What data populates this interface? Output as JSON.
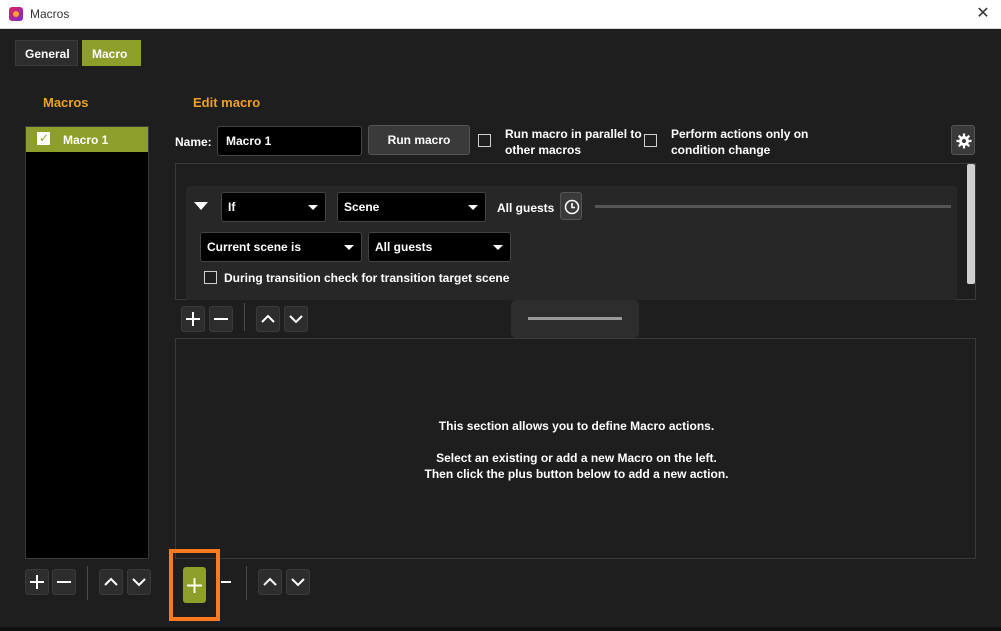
{
  "window": {
    "title": "Macros",
    "close_symbol": "✕"
  },
  "tabs": [
    {
      "label": "General",
      "active": false
    },
    {
      "label": "Macro",
      "active": true
    }
  ],
  "macros_panel": {
    "heading": "Macros",
    "items": [
      {
        "label": "Macro 1",
        "enabled": true,
        "selected": true
      }
    ],
    "controls": [
      "plus-icon",
      "minus-icon",
      "chevron-up-icon",
      "chevron-down-icon"
    ]
  },
  "edit": {
    "heading": "Edit macro",
    "name_label": "Name:",
    "name_value": "Macro 1",
    "run_button": "Run macro",
    "parallel_line1": "Run macro in parallel to",
    "parallel_line2": "other macros",
    "parallel_checked": false,
    "condition_line1": "Perform actions only on",
    "condition_line2": "condition change",
    "condition_checked": false,
    "settings_icon": "gear-icon"
  },
  "condition": {
    "logic": "If",
    "type": "Scene",
    "summary": "All guests",
    "compare": "Current scene is",
    "scene": "All guests",
    "transition_check_label": "During transition check for transition target scene",
    "transition_checked": false,
    "clock_icon": "clock-icon"
  },
  "actions": {
    "hint_line1": "This section allows you to define Macro actions.",
    "hint_line2": "Select an existing or add a new Macro on the left.",
    "hint_line3": "Then click the plus button below to add a new action."
  },
  "colors": {
    "accent": "#8e9e2a",
    "heading": "#f0a020",
    "highlight": "#ff7a1a",
    "background": "#1e1e1e"
  }
}
